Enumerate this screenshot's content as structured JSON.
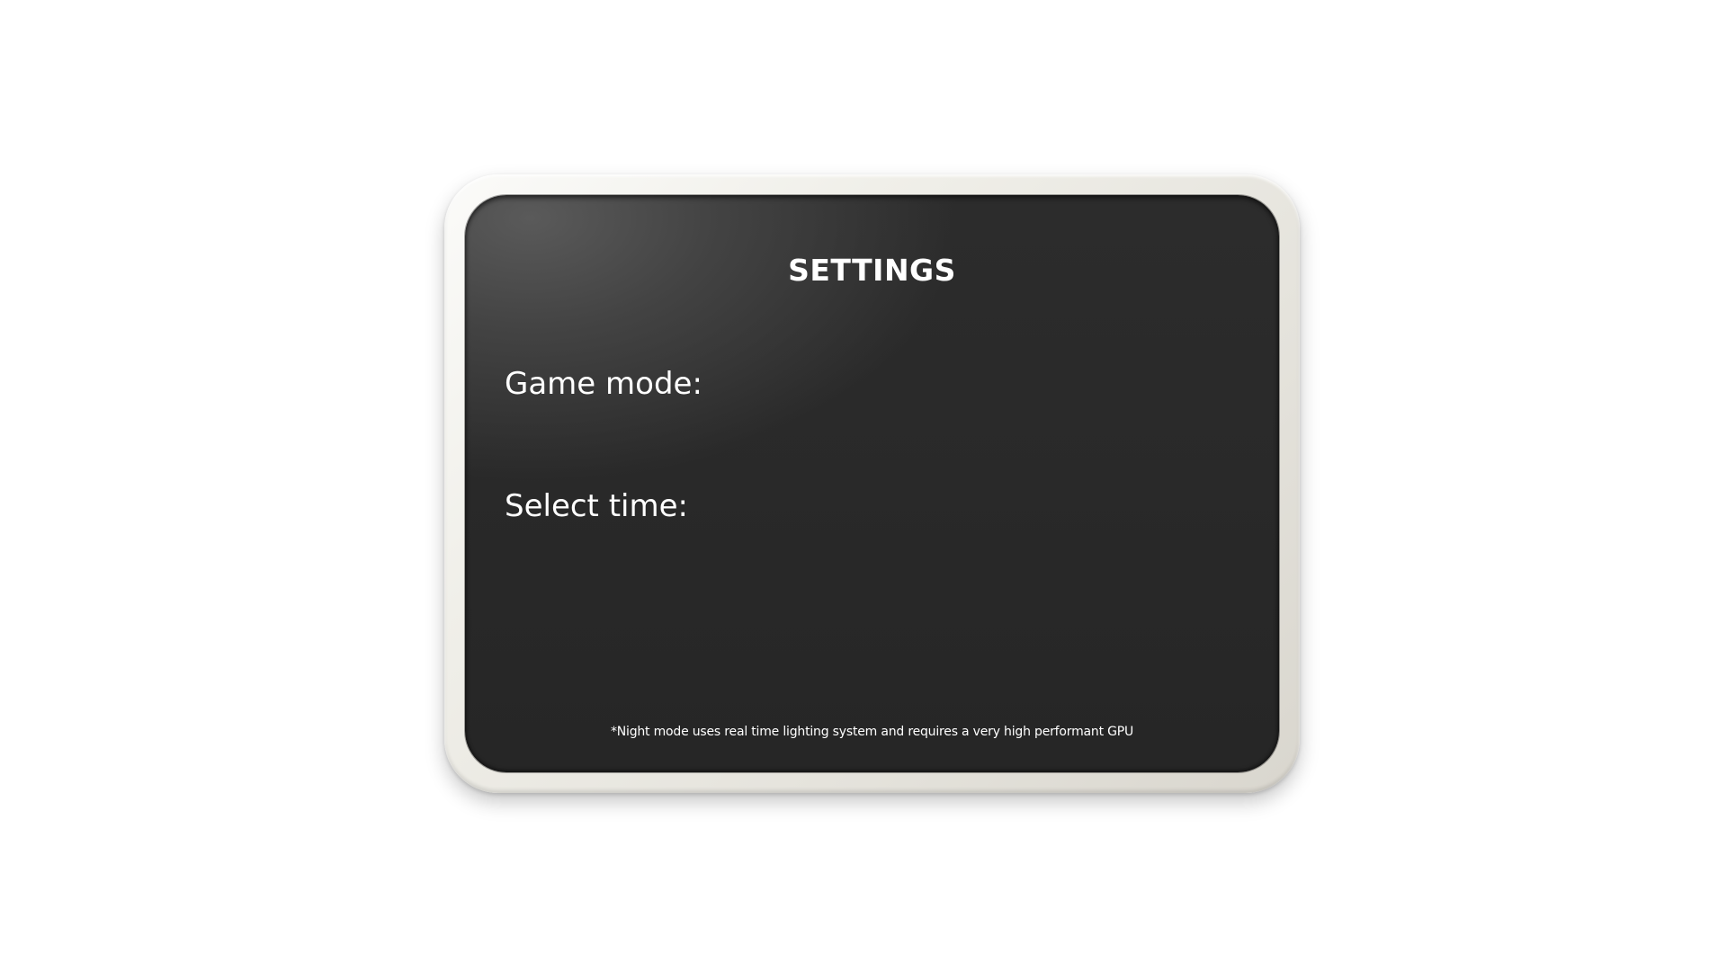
{
  "settings_panel": {
    "title": "SETTINGS",
    "game_mode_label": "Game mode:",
    "select_time_label": "Select time:",
    "footnote": "*Night mode uses real time lighting system and requires a very high performant GPU"
  },
  "colors": {
    "frame": "#e4e2db",
    "screen": "#2a2a2a",
    "text": "#ffffff",
    "background": "#ffffff"
  }
}
